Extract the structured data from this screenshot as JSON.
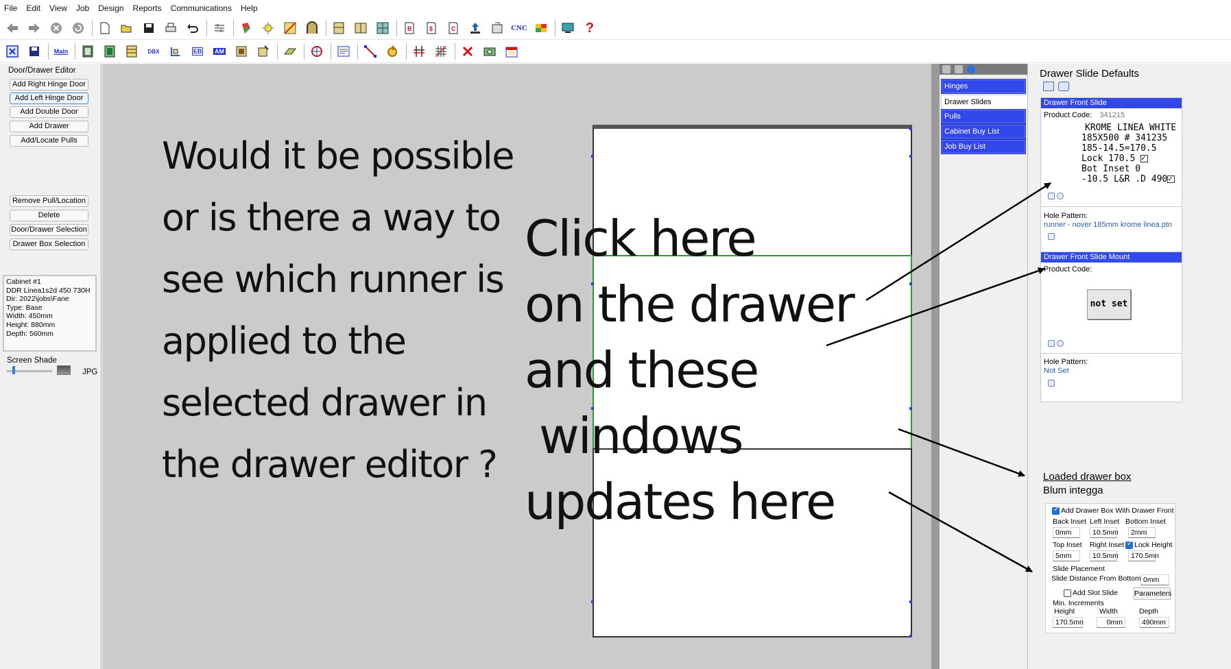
{
  "menu": [
    "File",
    "Edit",
    "View",
    "Job",
    "Design",
    "Reports",
    "Communications",
    "Help"
  ],
  "toolbar": {
    "cnc_label": "CNC",
    "main_label": "Main",
    "dbx_label": "DBX",
    "eb_label": "EB",
    "am_label": "AM",
    "letter_b": "B",
    "letter_s": "$",
    "letter_c": "C"
  },
  "left_panel": {
    "title": "Door/Drawer Editor",
    "buttons": [
      "Add Right Hinge Door",
      "Add Left Hinge Door",
      "Add Double Door",
      "Add Drawer",
      "Add/Locate Pulls"
    ],
    "buttons2": [
      "Remove Pull/Location",
      "Delete",
      "Door/Drawer Selection",
      "Drawer Box Selection"
    ],
    "cabinet_info": [
      "Cabinet #1",
      " DDR Linea1s2d 450 730H",
      "Dir: 2022\\jobs\\Fane",
      "Type: Base",
      "Width: 450mm",
      "Height: 880mm",
      "Depth: 560mm"
    ],
    "screen_shade_label": "Screen Shade",
    "jpg_label": "JPG"
  },
  "question_lines": [
    "Would it be possible",
    "or is there a way to",
    "see which runner is",
    "applied to the",
    "selected drawer in",
    "the drawer editor ?"
  ],
  "annotation_lines": [
    "Click here",
    "on the drawer",
    "and these",
    " windows",
    "updates here"
  ],
  "nav": {
    "items": [
      "Hinges",
      "Drawer Slides",
      "Pulls",
      "Cabinet Buy List",
      "Job Buy List"
    ],
    "selected": "Drawer Slides"
  },
  "props": {
    "title": "Drawer Slide Defaults",
    "front_slide": {
      "header": "Drawer Front Slide",
      "product_code_label": "Product Code:",
      "product_code": "341215",
      "note_lines": [
        "KROME LINEA WHITE",
        "185X500  # 341235",
        "185-14.5=170.5",
        "Lock 170.5",
        "Bot Inset 0",
        "-10.5 L&R .D 490"
      ],
      "hole_pattern_label": "Hole Pattern:",
      "hole_pattern": "runner - nover 185mm krome linea.ptn"
    },
    "front_slide_mount": {
      "header": "Drawer Front Slide Mount",
      "product_code_label": "Product Code:",
      "not_set_button": "not set",
      "hole_pattern_label": "Hole Pattern:",
      "hole_pattern": "Not Set"
    },
    "loaded_title": "Loaded drawer box",
    "loaded_value": "Blum  integga",
    "drawer_box": {
      "add_with_front_label": "Add Drawer Box With Drawer Front",
      "back_inset_label": "Back Inset",
      "left_inset_label": "Left Inset",
      "bottom_inset_label": "Bottom Inset",
      "back_inset": "0mm",
      "left_inset": "10.5mm",
      "bottom_inset": "2mm",
      "top_inset_label": "Top Inset",
      "right_inset_label": "Right Inset",
      "lock_height_label": "Lock Height",
      "top_inset": "5mm",
      "right_inset": "10.5mm",
      "lock_height": "170.5mn",
      "slide_placement_label": "Slide Placement",
      "slide_distance_label": "Slide Distance From Bottom",
      "slide_distance": "0mm",
      "add_slot_slide_label": "Add Slot Slide",
      "parameters_button": "Parameters",
      "min_increments_label": "Min. Increments",
      "height_label": "Height",
      "width_label": "Width",
      "depth_label": "Depth",
      "height": "170.5mn",
      "width": "0mm",
      "depth": "490mm"
    }
  },
  "colors": {
    "nav_blue": "#3348ea",
    "canvas_gray": "#cbcbcb",
    "selected_drawer_border": "#2e9a36",
    "handle_blue": "#2a3cdc",
    "hole_link": "#2a5fb8"
  }
}
